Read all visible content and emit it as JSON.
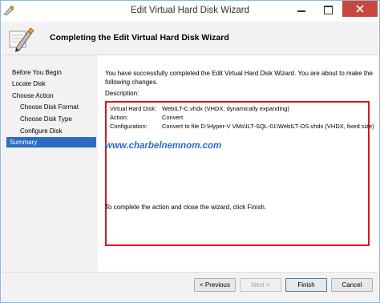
{
  "window": {
    "title": "Edit Virtual Hard Disk Wizard"
  },
  "header": {
    "title": "Completing the Edit Virtual Hard Disk Wizard"
  },
  "nav": {
    "items": [
      {
        "label": "Before You Begin",
        "sub": false,
        "selected": false
      },
      {
        "label": "Locate Disk",
        "sub": false,
        "selected": false
      },
      {
        "label": "Choose Action",
        "sub": false,
        "selected": false
      },
      {
        "label": "Choose Disk Format",
        "sub": true,
        "selected": false
      },
      {
        "label": "Choose Disk Type",
        "sub": true,
        "selected": false
      },
      {
        "label": "Configure Disk",
        "sub": true,
        "selected": false
      },
      {
        "label": "Summary",
        "sub": false,
        "selected": true
      }
    ]
  },
  "main": {
    "intro": "You have successfully completed the Edit Virtual Hard Disk Wizard. You are about to make the following changes.",
    "description_label": "Description:",
    "rows": [
      {
        "key": "Virtual Hard Disk:",
        "value": "WebILT-C.vhdx (VHDX, dynamically expanding)"
      },
      {
        "key": "Action:",
        "value": "Convert"
      },
      {
        "key": "Configuration:",
        "value": "Convert to file D:\\Hyper-V VMs\\ILT-SQL-01\\WebILT-OS.vhdx (VHDX, fixed size)"
      }
    ],
    "watermark": "www.charbelnemnom.com",
    "finish_note": "To complete the action and close the wizard, click Finish."
  },
  "footer": {
    "previous": "< Previous",
    "next": "Next >",
    "finish": "Finish",
    "cancel": "Cancel"
  },
  "colors": {
    "accent": "#2b6cc3",
    "highlight_border": "#d8171f",
    "watermark": "#2a6bd1",
    "close_button": "#c7473e"
  }
}
